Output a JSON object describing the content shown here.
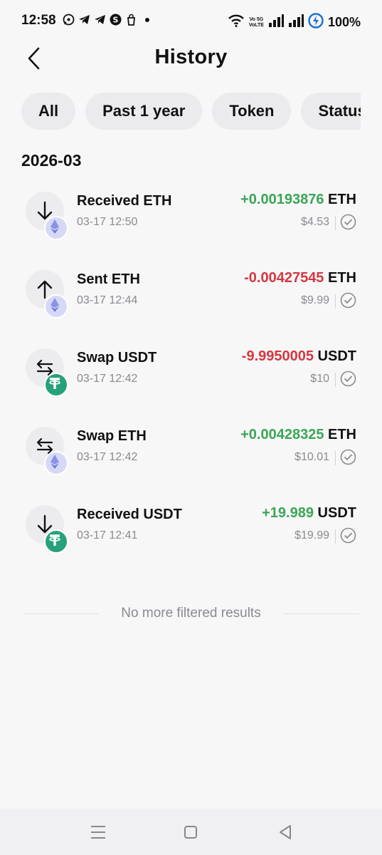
{
  "status_bar": {
    "time": "12:58",
    "app_icons": [
      "whatsapp-icon",
      "telegram-icon",
      "telegram-icon",
      "s-app-icon",
      "bag-icon",
      "dot-icon"
    ],
    "network_label_top": "Vo 5G",
    "network_label_bottom": "VoLTE",
    "battery": "100%"
  },
  "header": {
    "title": "History"
  },
  "filters": [
    {
      "label": "All"
    },
    {
      "label": "Past 1 year"
    },
    {
      "label": "Token"
    },
    {
      "label": "Status"
    }
  ],
  "month": "2026-03",
  "transactions": [
    {
      "title": "Received ETH",
      "time": "03-17 12:50",
      "amount": "+0.00193876",
      "unit": "ETH",
      "fiat": "$4.53",
      "direction": "receive",
      "token": "eth"
    },
    {
      "title": "Sent ETH",
      "time": "03-17 12:44",
      "amount": "-0.00427545",
      "unit": "ETH",
      "fiat": "$9.99",
      "direction": "send",
      "token": "eth"
    },
    {
      "title": "Swap USDT",
      "time": "03-17 12:42",
      "amount": "-9.9950005",
      "unit": "USDT",
      "fiat": "$10",
      "direction": "swap",
      "token": "usdt"
    },
    {
      "title": "Swap ETH",
      "time": "03-17 12:42",
      "amount": "+0.00428325",
      "unit": "ETH",
      "fiat": "$10.01",
      "direction": "swap",
      "token": "eth"
    },
    {
      "title": "Received USDT",
      "time": "03-17 12:41",
      "amount": "+19.989",
      "unit": "USDT",
      "fiat": "$19.99",
      "direction": "receive",
      "token": "usdt"
    }
  ],
  "end_message": "No more filtered results",
  "colors": {
    "positive": "#3aa655",
    "negative": "#d6373f",
    "muted": "#8a8a90",
    "chip_bg": "#ebebee"
  }
}
